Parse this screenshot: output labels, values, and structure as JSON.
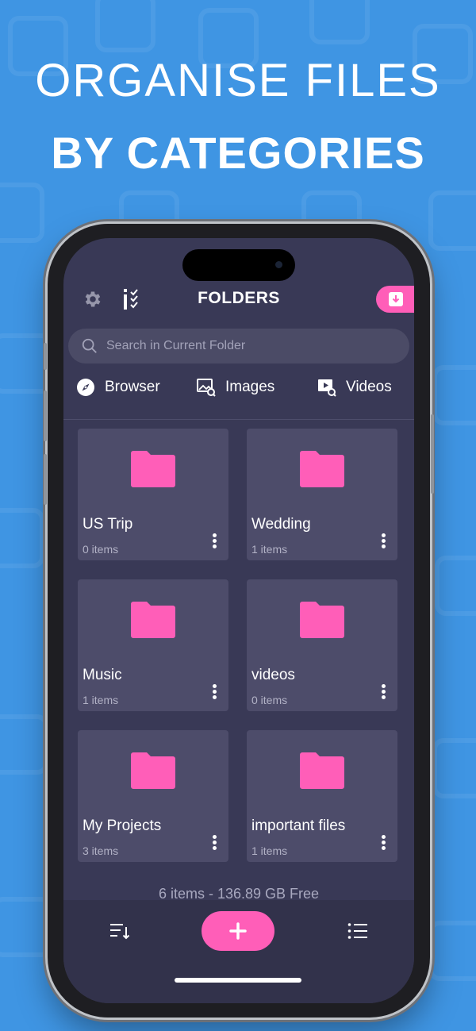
{
  "headline": {
    "line1": "ORGANISE FILES",
    "line2": "BY CATEGORIES"
  },
  "header": {
    "title": "FOLDERS"
  },
  "search": {
    "placeholder": "Search in Current Folder"
  },
  "categories": [
    {
      "label": "Browser",
      "icon": "compass-icon"
    },
    {
      "label": "Images",
      "icon": "image-search-icon"
    },
    {
      "label": "Videos",
      "icon": "video-search-icon"
    }
  ],
  "folders": [
    {
      "name": "US Trip",
      "count": "0 items"
    },
    {
      "name": "Wedding",
      "count": "1 items"
    },
    {
      "name": "Music",
      "count": "1 items"
    },
    {
      "name": "videos",
      "count": "0 items"
    },
    {
      "name": "My Projects",
      "count": "3 items"
    },
    {
      "name": "important files",
      "count": "1 items"
    }
  ],
  "footer": {
    "summary": "6 items - 136.89 GB Free"
  },
  "colors": {
    "accent": "#ff5eb8",
    "background": "#3f95e3",
    "screen": "#393956",
    "card": "#4d4c6a"
  }
}
